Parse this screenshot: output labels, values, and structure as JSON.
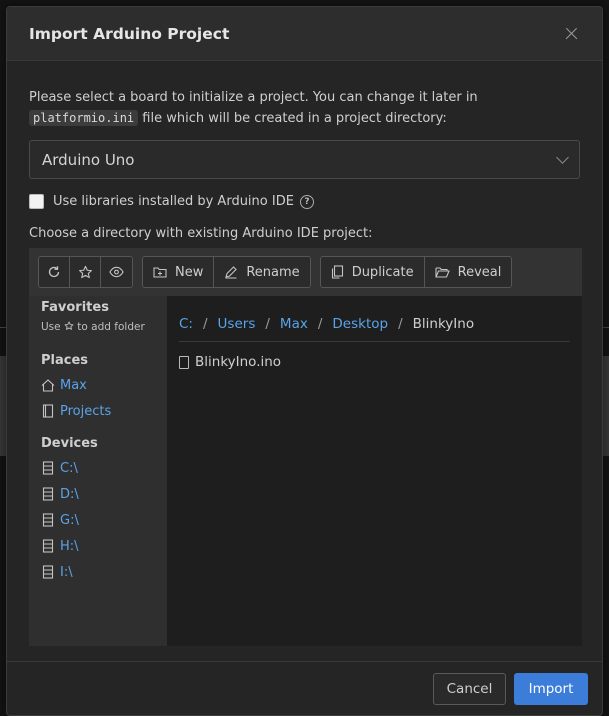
{
  "dialog": {
    "title": "Import Arduino Project",
    "intro_before": "Please select a board to initialize a project. You can change it later in ",
    "intro_code": "platformio.ini",
    "intro_after": " file which will be created in a project directory:",
    "board_selected": "Arduino Uno",
    "use_libraries_label": "Use libraries installed by Arduino IDE",
    "use_libraries_checked": false,
    "help_glyph": "?",
    "choose_label": "Choose a directory with existing Arduino IDE project:"
  },
  "toolbar": {
    "new_label": "New",
    "rename_label": "Rename",
    "duplicate_label": "Duplicate",
    "reveal_label": "Reveal"
  },
  "sidebar": {
    "favorites_title": "Favorites",
    "favorites_hint_before": "Use ",
    "favorites_hint_after": " to add folder",
    "places_title": "Places",
    "places": [
      "Max",
      "Projects"
    ],
    "devices_title": "Devices",
    "devices": [
      "C:\\",
      "D:\\",
      "G:\\",
      "H:\\",
      "I:\\"
    ]
  },
  "breadcrumb": [
    "C:",
    "Users",
    "Max",
    "Desktop",
    "BlinkyIno"
  ],
  "breadcrumb_separator": "/",
  "files": [
    "BlinkyIno.ino"
  ],
  "footer": {
    "cancel_label": "Cancel",
    "import_label": "Import"
  },
  "colors": {
    "accent": "#3b7dd8",
    "link": "#5aa3e8",
    "panel": "#252526"
  }
}
